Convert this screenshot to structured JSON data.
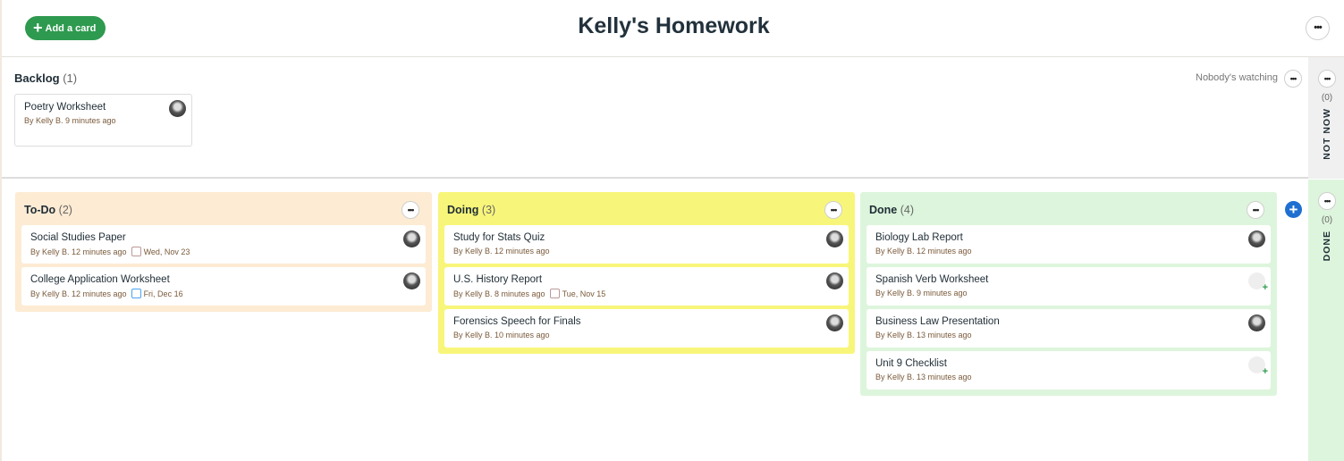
{
  "header": {
    "add_card": "Add a card",
    "title": "Kelly's Homework"
  },
  "backlog": {
    "title": "Backlog",
    "count": "(1)",
    "watching": "Nobody's watching",
    "cards": [
      {
        "name": "Poetry Worksheet",
        "meta": "By Kelly B. 9 minutes ago"
      }
    ]
  },
  "columns": [
    {
      "title": "To-Do",
      "count": "(2)",
      "color": "#fdebd3",
      "cards": [
        {
          "name": "Social Studies Paper",
          "meta": "By Kelly B. 12 minutes ago",
          "due": "Wed, Nov 23"
        },
        {
          "name": "College Application Worksheet",
          "meta": "By Kelly B. 12 minutes ago",
          "due": "Fri, Dec 16"
        }
      ]
    },
    {
      "title": "Doing",
      "count": "(3)",
      "color": "#f8f67a",
      "cards": [
        {
          "name": "Study for Stats Quiz",
          "meta": "By Kelly B. 12 minutes ago"
        },
        {
          "name": "U.S. History Report",
          "meta": "By Kelly B. 8 minutes ago",
          "due": "Tue, Nov 15"
        },
        {
          "name": "Forensics Speech for Finals",
          "meta": "By Kelly B. 10 minutes ago"
        }
      ]
    },
    {
      "title": "Done",
      "count": "(4)",
      "color": "#ddf5dc",
      "cards": [
        {
          "name": "Biology Lab Report",
          "meta": "By Kelly B. 12 minutes ago"
        },
        {
          "name": "Spanish Verb Worksheet",
          "meta": "By Kelly B. 9 minutes ago"
        },
        {
          "name": "Business Law Presentation",
          "meta": "By Kelly B. 13 minutes ago"
        },
        {
          "name": "Unit 9 Checklist",
          "meta": "By Kelly B. 13 minutes ago"
        }
      ]
    }
  ],
  "side": {
    "not_now": {
      "label": "NOT NOW",
      "count": "(0)"
    },
    "done": {
      "label": "DONE",
      "count": "(0)"
    }
  }
}
